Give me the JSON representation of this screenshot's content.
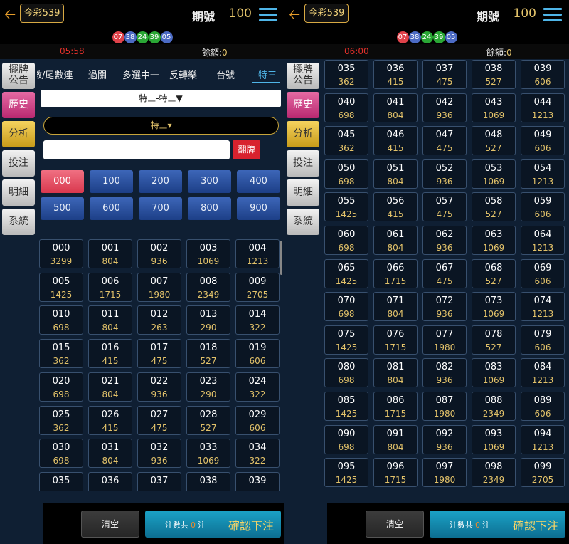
{
  "colors": {
    "ball_red": "#e0424a",
    "ball_blue": "#4c6bc4",
    "ball_green": "#2aa735",
    "accent": "#4fb5e8",
    "gold": "#e2c26a"
  },
  "left": {
    "lottery": "今彩539",
    "period_label": "期號",
    "period_value": "100",
    "balls": [
      {
        "n": "07",
        "c": "red"
      },
      {
        "n": "38",
        "c": "blue"
      },
      {
        "n": "24",
        "c": "green"
      },
      {
        "n": "39",
        "c": "green"
      },
      {
        "n": "05",
        "c": "blue"
      }
    ],
    "timer": "05:58",
    "balance_label": "餘額:",
    "balance_value": "0",
    "sidebar": [
      "擺牌公告",
      "歷史",
      "分析",
      "投注",
      "明細",
      "系統"
    ],
    "tabs": [
      "數/尾數連",
      "過關",
      "多選中一",
      "反轉樂",
      "台號",
      "特三"
    ],
    "dropdown1": "特三-特三▼",
    "dropdown2": "特三▾",
    "fan_button": "翻牌",
    "hundreds": [
      "000",
      "100",
      "200",
      "300",
      "400",
      "500",
      "600",
      "700",
      "800",
      "900"
    ],
    "cells": [
      [
        "000",
        "3299"
      ],
      [
        "001",
        "804"
      ],
      [
        "002",
        "936"
      ],
      [
        "003",
        "1069"
      ],
      [
        "004",
        "1213"
      ],
      [
        "005",
        "1425"
      ],
      [
        "006",
        "1715"
      ],
      [
        "007",
        "1980"
      ],
      [
        "008",
        "2349"
      ],
      [
        "009",
        "2705"
      ],
      [
        "010",
        "698"
      ],
      [
        "011",
        "804"
      ],
      [
        "012",
        "263"
      ],
      [
        "013",
        "290"
      ],
      [
        "014",
        "322"
      ],
      [
        "015",
        "362"
      ],
      [
        "016",
        "415"
      ],
      [
        "017",
        "475"
      ],
      [
        "018",
        "527"
      ],
      [
        "019",
        "606"
      ],
      [
        "020",
        "698"
      ],
      [
        "021",
        "804"
      ],
      [
        "022",
        "936"
      ],
      [
        "023",
        "290"
      ],
      [
        "024",
        "322"
      ],
      [
        "025",
        "362"
      ],
      [
        "026",
        "415"
      ],
      [
        "027",
        "475"
      ],
      [
        "028",
        "527"
      ],
      [
        "029",
        "606"
      ],
      [
        "030",
        "698"
      ],
      [
        "031",
        "804"
      ],
      [
        "032",
        "936"
      ],
      [
        "033",
        "1069"
      ],
      [
        "034",
        "322"
      ],
      [
        "035",
        ""
      ],
      [
        "036",
        ""
      ],
      [
        "037",
        ""
      ],
      [
        "038",
        ""
      ],
      [
        "039",
        ""
      ]
    ],
    "clear": "清空",
    "count_label": "注數共",
    "count": "0",
    "count_unit": "注",
    "confirm": "確認下注"
  },
  "right": {
    "lottery": "今彩539",
    "period_label": "期號",
    "period_value": "100",
    "balls": [
      {
        "n": "07",
        "c": "red"
      },
      {
        "n": "38",
        "c": "blue"
      },
      {
        "n": "24",
        "c": "green"
      },
      {
        "n": "39",
        "c": "green"
      },
      {
        "n": "05",
        "c": "blue"
      }
    ],
    "timer": "06:00",
    "balance_label": "餘額:",
    "balance_value": "0",
    "sidebar": [
      "擺牌公告",
      "歷史",
      "分析",
      "投注",
      "明細",
      "系統"
    ],
    "cells": [
      [
        "035",
        "362"
      ],
      [
        "036",
        "415"
      ],
      [
        "037",
        "475"
      ],
      [
        "038",
        "527"
      ],
      [
        "039",
        "606"
      ],
      [
        "040",
        "698"
      ],
      [
        "041",
        "804"
      ],
      [
        "042",
        "936"
      ],
      [
        "043",
        "1069"
      ],
      [
        "044",
        "1213"
      ],
      [
        "045",
        "362"
      ],
      [
        "046",
        "415"
      ],
      [
        "047",
        "475"
      ],
      [
        "048",
        "527"
      ],
      [
        "049",
        "606"
      ],
      [
        "050",
        "698"
      ],
      [
        "051",
        "804"
      ],
      [
        "052",
        "936"
      ],
      [
        "053",
        "1069"
      ],
      [
        "054",
        "1213"
      ],
      [
        "055",
        "1425"
      ],
      [
        "056",
        "415"
      ],
      [
        "057",
        "475"
      ],
      [
        "058",
        "527"
      ],
      [
        "059",
        "606"
      ],
      [
        "060",
        "698"
      ],
      [
        "061",
        "804"
      ],
      [
        "062",
        "936"
      ],
      [
        "063",
        "1069"
      ],
      [
        "064",
        "1213"
      ],
      [
        "065",
        "1425"
      ],
      [
        "066",
        "1715"
      ],
      [
        "067",
        "475"
      ],
      [
        "068",
        "527"
      ],
      [
        "069",
        "606"
      ],
      [
        "070",
        "698"
      ],
      [
        "071",
        "804"
      ],
      [
        "072",
        "936"
      ],
      [
        "073",
        "1069"
      ],
      [
        "074",
        "1213"
      ],
      [
        "075",
        "1425"
      ],
      [
        "076",
        "1715"
      ],
      [
        "077",
        "1980"
      ],
      [
        "078",
        "527"
      ],
      [
        "079",
        "606"
      ],
      [
        "080",
        "698"
      ],
      [
        "081",
        "804"
      ],
      [
        "082",
        "936"
      ],
      [
        "083",
        "1069"
      ],
      [
        "084",
        "1213"
      ],
      [
        "085",
        "1425"
      ],
      [
        "086",
        "1715"
      ],
      [
        "087",
        "1980"
      ],
      [
        "088",
        "2349"
      ],
      [
        "089",
        "606"
      ],
      [
        "090",
        "698"
      ],
      [
        "091",
        "804"
      ],
      [
        "092",
        "936"
      ],
      [
        "093",
        "1069"
      ],
      [
        "094",
        "1213"
      ],
      [
        "095",
        "1425"
      ],
      [
        "096",
        "1715"
      ],
      [
        "097",
        "1980"
      ],
      [
        "098",
        "2349"
      ],
      [
        "099",
        "2705"
      ]
    ],
    "clear": "清空",
    "count_label": "注數共",
    "count": "0",
    "count_unit": "注",
    "confirm": "確認下注"
  }
}
